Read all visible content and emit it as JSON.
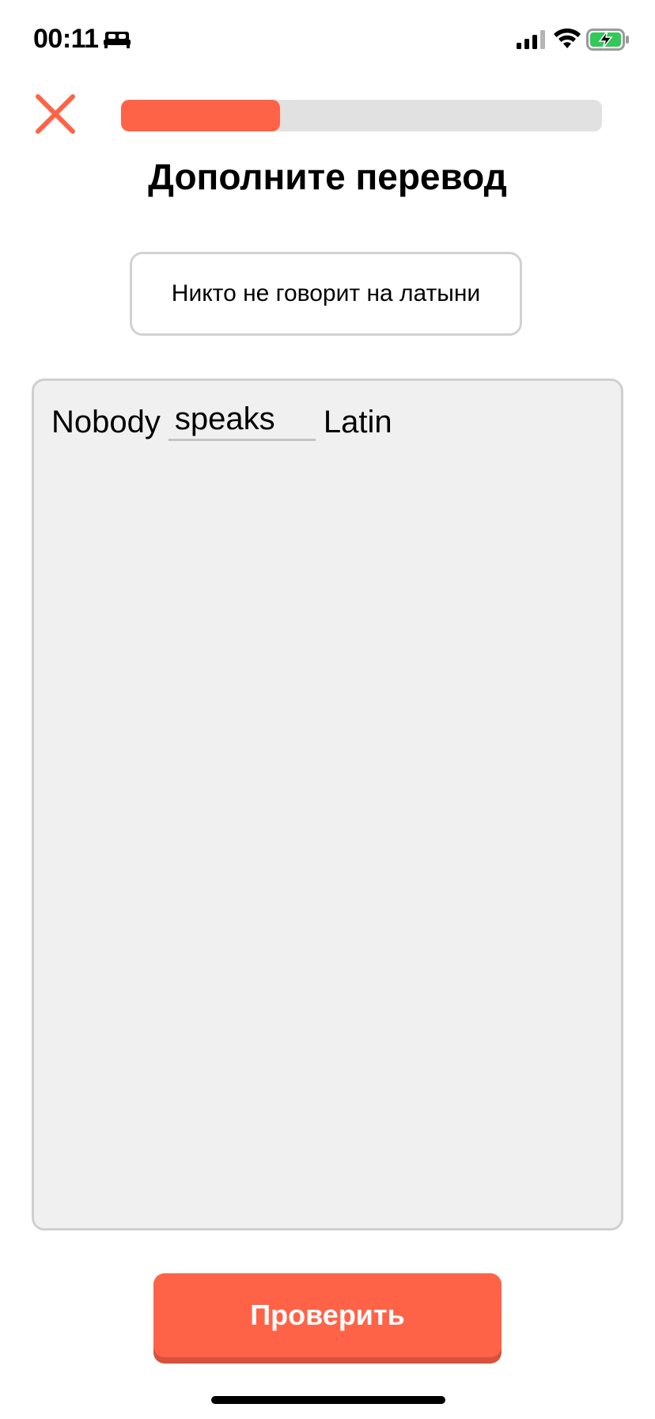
{
  "status_bar": {
    "time": "00:11",
    "focus_icon": "bed-icon",
    "signal_icon": "cellular-signal-icon",
    "wifi_icon": "wifi-icon",
    "battery_icon": "battery-charging-icon",
    "battery_color": "#34c759"
  },
  "header": {
    "close_icon": "close-icon",
    "progress": 0.33,
    "accent_color": "#ff6347"
  },
  "exercise": {
    "title": "Дополните перевод",
    "source_sentence": "Никто не говорит на латыни",
    "answer": {
      "word_before": "Nobody",
      "blank_value": "speaks",
      "word_after": "Latin"
    }
  },
  "footer": {
    "check_label": "Проверить"
  }
}
